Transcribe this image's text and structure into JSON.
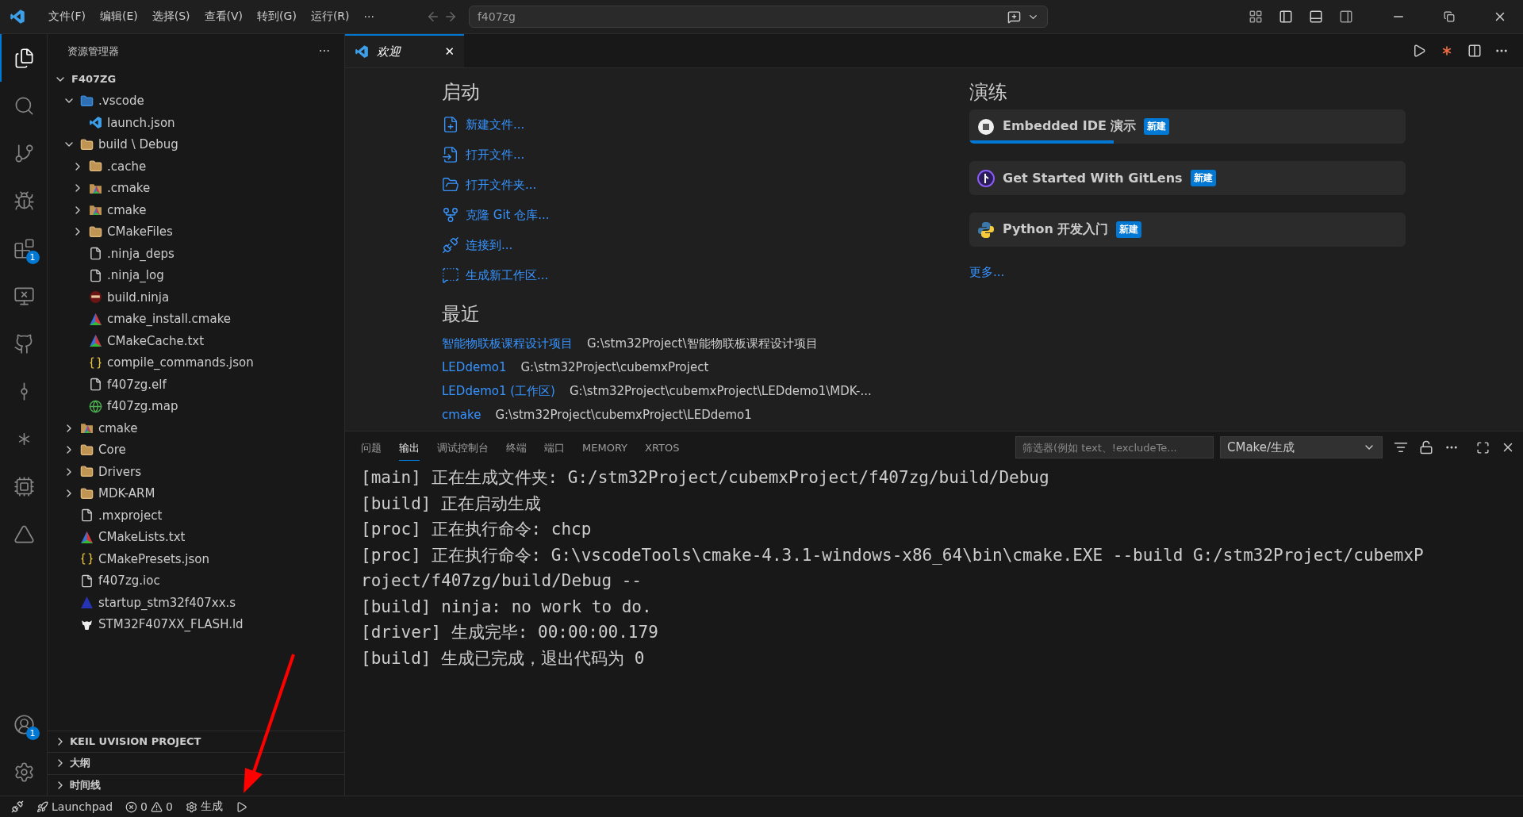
{
  "title_bar": {
    "menus": [
      "文件(F)",
      "编辑(E)",
      "选择(S)",
      "查看(V)",
      "转到(G)",
      "运行(R)",
      "···"
    ],
    "search": {
      "value": "f407zg"
    }
  },
  "activity_bar": {
    "items": [
      {
        "kind": "files",
        "selected": true
      },
      {
        "kind": "search",
        "selected": false
      },
      {
        "kind": "git",
        "selected": false
      },
      {
        "kind": "debug",
        "selected": false
      },
      {
        "kind": "extensions",
        "selected": false,
        "badge": "1"
      },
      {
        "kind": "remote",
        "selected": false
      },
      {
        "kind": "github",
        "selected": false
      },
      {
        "kind": "gitlens",
        "selected": false
      },
      {
        "kind": "spark",
        "selected": false
      },
      {
        "kind": "chip",
        "selected": false
      },
      {
        "kind": "cmake",
        "selected": false
      }
    ],
    "bottom": [
      {
        "kind": "account",
        "badge": "1"
      },
      {
        "kind": "settings"
      }
    ]
  },
  "sidebar": {
    "title": "资源管理器",
    "more": "···",
    "root": {
      "label": "F407ZG",
      "expanded": true
    },
    "tree": [
      {
        "label": ".vscode",
        "kind": "vscode-folder",
        "expanded": true,
        "children": [
          {
            "label": "launch.json",
            "kind": "vscode"
          }
        ]
      },
      {
        "label": "build \\ Debug",
        "kind": "folder",
        "expanded": true,
        "children": [
          {
            "label": ".cache",
            "kind": "folder",
            "expanded": false
          },
          {
            "label": ".cmake",
            "kind": "cmake-folder",
            "expanded": false
          },
          {
            "label": "cmake",
            "kind": "cmake-folder",
            "expanded": false
          },
          {
            "label": "CMakeFiles",
            "kind": "folder",
            "expanded": false
          },
          {
            "label": ".ninja_deps",
            "kind": "file"
          },
          {
            "label": ".ninja_log",
            "kind": "file"
          },
          {
            "label": "build.ninja",
            "kind": "ninja"
          },
          {
            "label": "cmake_install.cmake",
            "kind": "cmake"
          },
          {
            "label": "CMakeCache.txt",
            "kind": "cmake"
          },
          {
            "label": "compile_commands.json",
            "kind": "json"
          },
          {
            "label": "f407zg.elf",
            "kind": "file"
          },
          {
            "label": "f407zg.map",
            "kind": "globe"
          }
        ]
      },
      {
        "label": "cmake",
        "kind": "cmake-folder",
        "expanded": false
      },
      {
        "label": "Core",
        "kind": "folder",
        "expanded": false
      },
      {
        "label": "Drivers",
        "kind": "folder",
        "expanded": false
      },
      {
        "label": "MDK-ARM",
        "kind": "folder",
        "expanded": false
      },
      {
        "label": ".mxproject",
        "kind": "file"
      },
      {
        "label": "CMakeLists.txt",
        "kind": "cmake"
      },
      {
        "label": "CMakePresets.json",
        "kind": "json"
      },
      {
        "label": "f407zg.ioc",
        "kind": "file"
      },
      {
        "label": "startup_stm32f407xx.s",
        "kind": "asm"
      },
      {
        "label": "STM32F407XX_FLASH.ld",
        "kind": "gnu"
      }
    ],
    "sections": [
      {
        "label": "KEIL UVISION PROJECT",
        "expanded": false
      },
      {
        "label": "大纲",
        "expanded": false
      },
      {
        "label": "时间线",
        "expanded": false
      }
    ]
  },
  "editor": {
    "tabs": [
      {
        "label": "欢迎",
        "selected": true,
        "close": "✕"
      }
    ],
    "welcome": {
      "start": {
        "heading": "启动",
        "items": [
          {
            "label": "新建文件...",
            "kind": "new-file"
          },
          {
            "label": "打开文件...",
            "kind": "open-file"
          },
          {
            "label": "打开文件夹...",
            "kind": "open-folder"
          },
          {
            "label": "克隆 Git 仓库...",
            "kind": "clone"
          },
          {
            "label": "连接到...",
            "kind": "remote"
          },
          {
            "label": "生成新工作区...",
            "kind": "chat"
          }
        ]
      },
      "recent": {
        "heading": "最近",
        "items": [
          {
            "name": "智能物联板课程设计项目",
            "path": "G:\\stm32Project\\智能物联板课程设计项目"
          },
          {
            "name": "LEDdemo1",
            "path": "G:\\stm32Project\\cubemxProject"
          },
          {
            "name": "LEDdemo1 (工作区)",
            "path": "G:\\stm32Project\\cubemxProject\\LEDdemo1\\MDK-..."
          },
          {
            "name": "cmake",
            "path": "G:\\stm32Project\\cubemxProject\\LEDdemo1"
          }
        ]
      },
      "walkthroughs": {
        "heading": "演练",
        "items": [
          {
            "title": "Embedded IDE 演示",
            "badge": "新建",
            "kind": "chip",
            "level": 0.33
          },
          {
            "title": "Get Started With GitLens",
            "badge": "新建",
            "kind": "gitlens"
          },
          {
            "title": "Python 开发入门",
            "badge": "新建",
            "kind": "python"
          }
        ],
        "more": "更多..."
      }
    }
  },
  "panel": {
    "tabs": [
      {
        "label": "问题",
        "selected": false
      },
      {
        "label": "输出",
        "selected": true
      },
      {
        "label": "调试控制台",
        "selected": false
      },
      {
        "label": "终端",
        "selected": false
      },
      {
        "label": "端口",
        "selected": false
      },
      {
        "label": "MEMORY",
        "selected": false
      },
      {
        "label": "XRTOS",
        "selected": false
      }
    ],
    "filter": {
      "placeholder": "筛选器(例如 text、!excludeTe..."
    },
    "channel": "CMake/生成",
    "output": [
      "[main] 正在生成文件夹: G:/stm32Project/cubemxProject/f407zg/build/Debug",
      "[build] 正在启动生成",
      "[proc] 正在执行命令: chcp",
      "[proc] 正在执行命令: G:\\vscodeTools\\cmake-4.3.1-windows-x86_64\\bin\\cmake.EXE --build G:/stm32Project/cubemxProject/f407zg/build/Debug --",
      "[build] ninja: no work to do.",
      "[driver] 生成完毕: 00:00:00.179",
      "[build] 生成已完成，退出代码为 0"
    ]
  },
  "status_bar": {
    "launchpad": "Launchpad",
    "errors": "0",
    "warnings": "0",
    "build": "生成"
  }
}
